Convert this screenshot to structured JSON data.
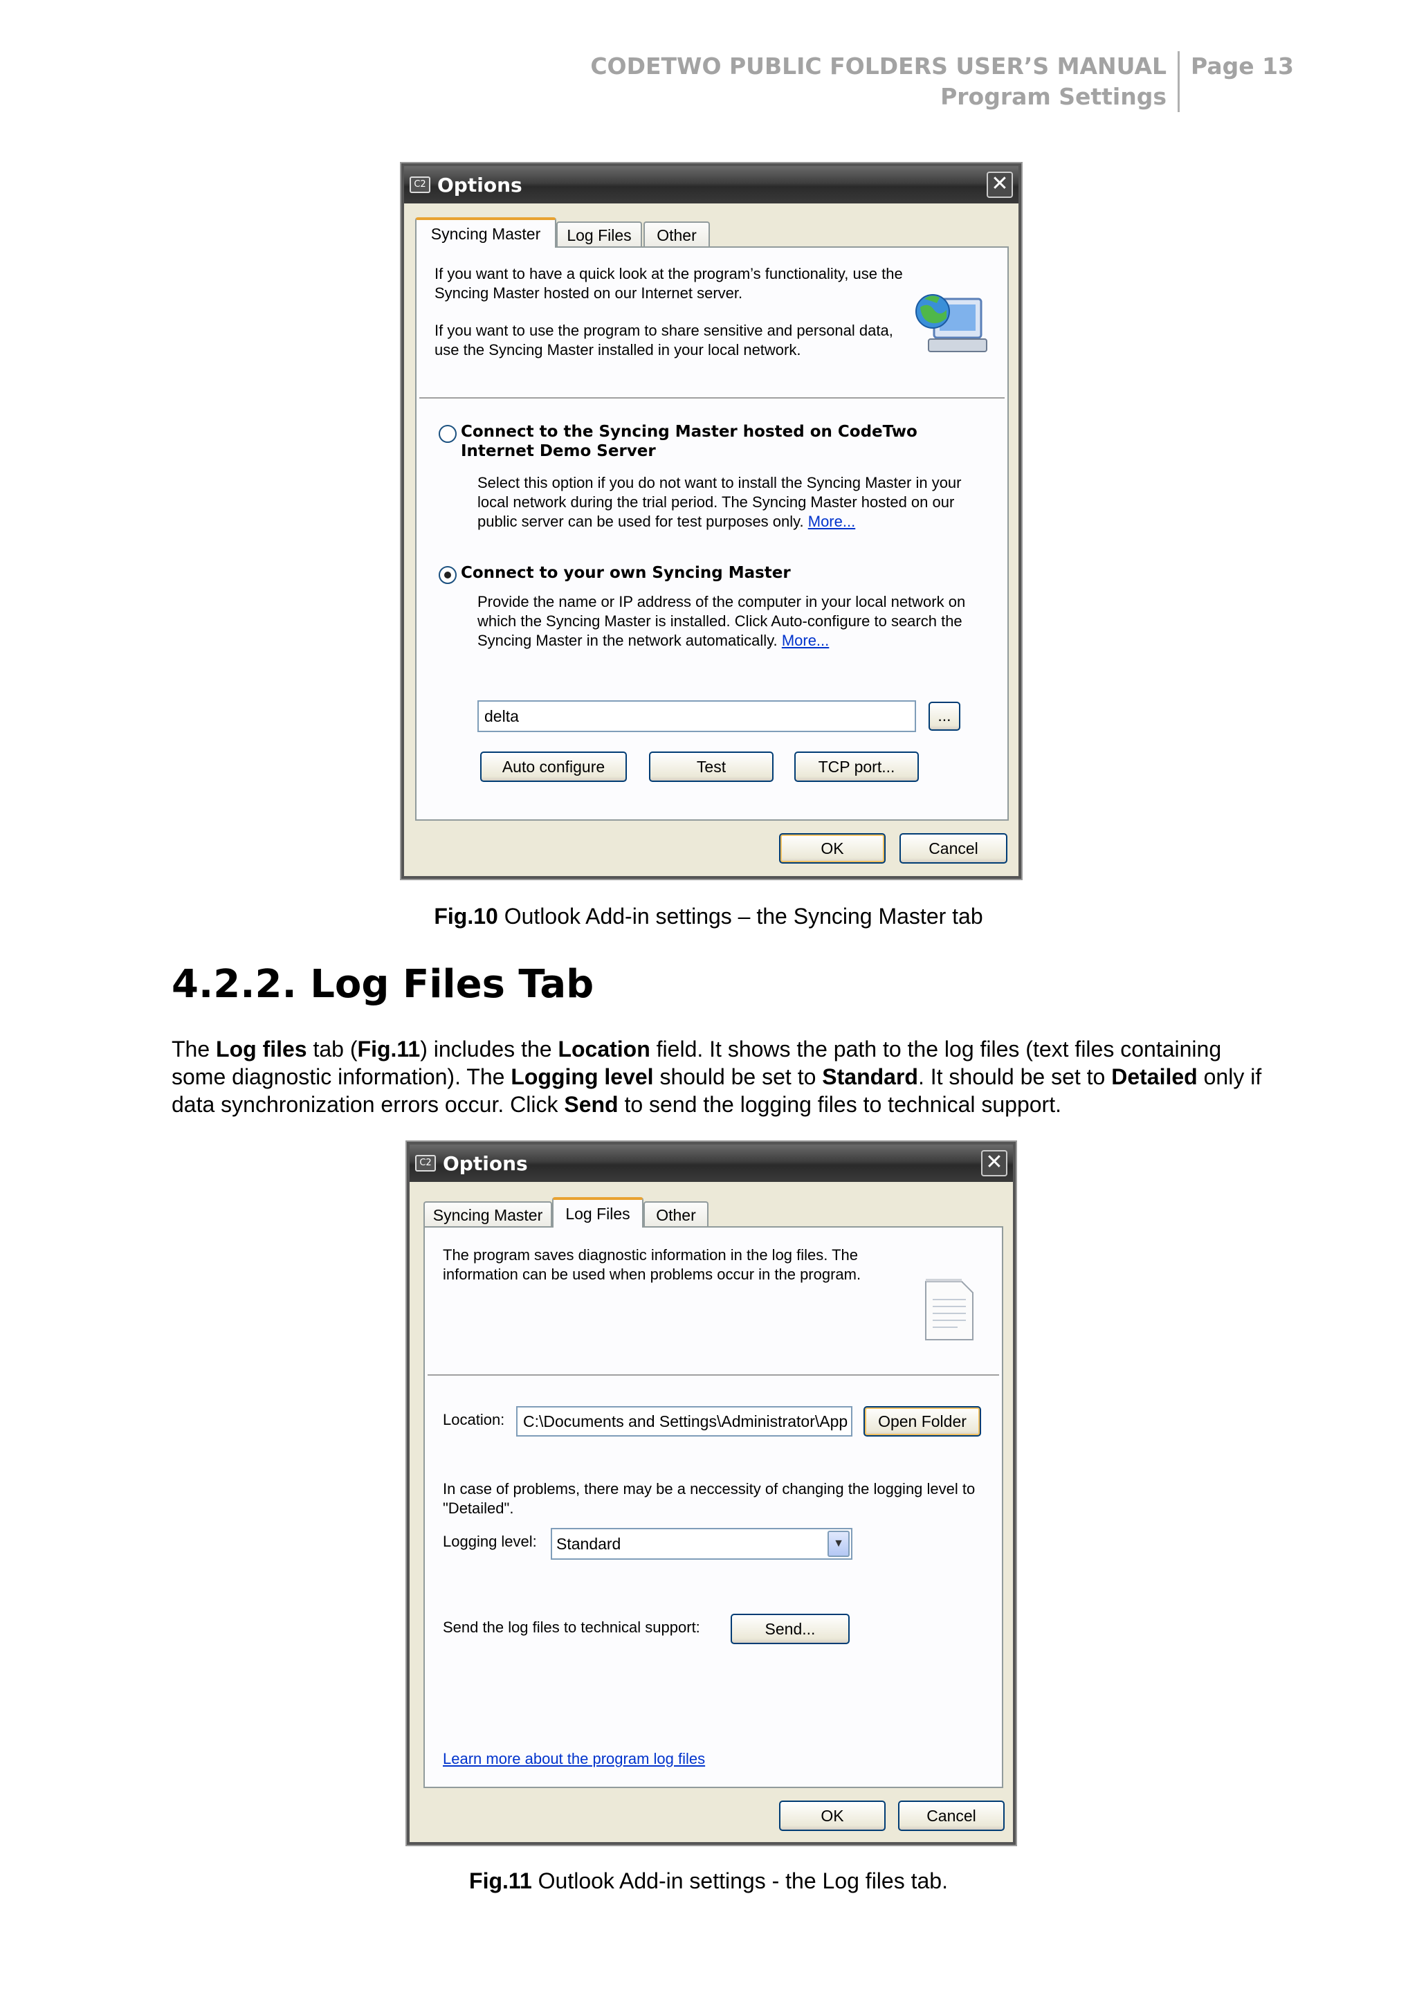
{
  "header": {
    "manual_title": "CODETWO PUBLIC FOLDERS USER’S MANUAL",
    "section": "Program Settings",
    "page": "Page 13"
  },
  "fig10": {
    "dialog": {
      "title": "Options",
      "close": "✕",
      "app_icon": "C2",
      "tabs": [
        "Syncing Master",
        "Log Files",
        "Other"
      ],
      "intro1": "If you want to have a quick look at the program’s functionality, use the Syncing Master hosted on our Internet server.",
      "intro2": "If you want to use the program to share sensitive and personal data, use the Syncing Master installed in your local network.",
      "option1_label": "Connect to the Syncing Master hosted on CodeTwo Internet Demo Server",
      "option1_desc": "Select this option if you do not want to install the Syncing Master in your local network during the trial period. The Syncing Master hosted on our public server can be used for test purposes only.",
      "option1_more": "More...",
      "option2_label": "Connect to your own Syncing Master",
      "option2_desc": "Provide the name or IP address of the computer in your local network on which the Syncing Master is installed. Click Auto-configure to search the Syncing Master in the network automatically.",
      "option2_more": "More...",
      "host_value": "delta",
      "browse": "...",
      "auto_configure": "Auto configure",
      "test": "Test",
      "tcp_port": "TCP port...",
      "ok": "OK",
      "cancel": "Cancel"
    },
    "caption_label": "Fig.10",
    "caption_text": " Outlook Add-in settings – the Syncing Master tab"
  },
  "section": {
    "heading": "4.2.2. Log Files Tab",
    "p_parts": [
      "The ",
      "Log files",
      " tab (",
      "Fig.11",
      ") includes the ",
      "Location",
      " field. It shows the path to the log files (text files containing some diagnostic information). The ",
      "Logging level",
      " should be set to ",
      "Standard",
      ". It should be set to ",
      "Detailed",
      " only if data synchronization errors occur. Click ",
      "Send",
      " to send the logging files to technical support."
    ]
  },
  "fig11": {
    "dialog": {
      "title": "Options",
      "close": "✕",
      "app_icon": "C2",
      "tabs": [
        "Syncing Master",
        "Log Files",
        "Other"
      ],
      "intro": "The program saves diagnostic information in the log files. The information can be used when problems occur in the program.",
      "location_label": "Location:",
      "location_value": "C:\\Documents and Settings\\Administrator\\App",
      "open_folder": "Open Folder",
      "problems_text": "In case of problems, there may be a neccessity of changing the logging level to \"Detailed\".",
      "logging_label": "Logging level:",
      "logging_value": "Standard",
      "send_label": "Send the log files to technical support:",
      "send": "Send...",
      "learn_more": "Learn more about the program log files",
      "ok": "OK",
      "cancel": "Cancel"
    },
    "caption_label": "Fig.11",
    "caption_text": " Outlook Add-in settings - the Log files tab."
  },
  "icons": {
    "network_computer": "network-computer-icon",
    "log_file": "text-file-icon",
    "dropdown": "▼"
  }
}
